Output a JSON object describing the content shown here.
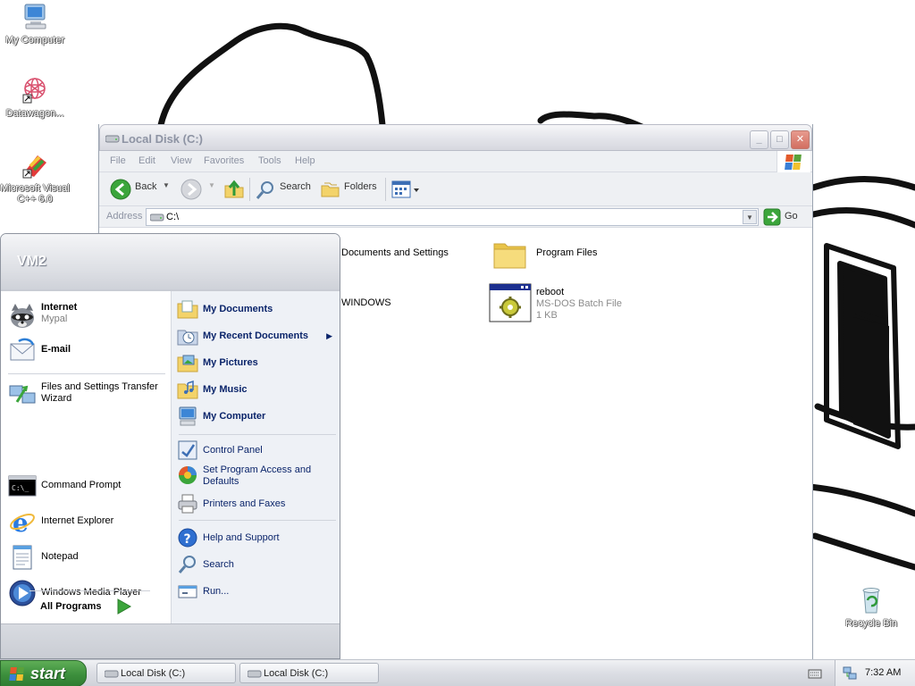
{
  "desktop": {
    "icons": [
      {
        "label": "My Computer",
        "icon": "my-computer-icon"
      },
      {
        "label": "Datawagon...",
        "icon": "datawagon-icon"
      },
      {
        "label": "Microsoft Visual C++ 6.0",
        "icon": "visual-cpp-icon"
      },
      {
        "label": "Recycle Bin",
        "icon": "recycle-bin-icon"
      }
    ]
  },
  "explorer": {
    "title": "Local Disk (C:)",
    "menu": [
      "File",
      "Edit",
      "View",
      "Favorites",
      "Tools",
      "Help"
    ],
    "toolbar": {
      "back": "Back",
      "search": "Search",
      "folders": "Folders"
    },
    "address": {
      "label": "Address",
      "value": "C:\\",
      "go": "Go"
    },
    "files": [
      {
        "name": "Documents and Settings",
        "type": "folder"
      },
      {
        "name": "Program Files",
        "type": "folder"
      },
      {
        "name": "WINDOWS",
        "type": "folder"
      },
      {
        "name": "reboot",
        "type": "batch",
        "detail": "MS-DOS Batch File",
        "size": "1 KB"
      }
    ]
  },
  "start_menu": {
    "user": "VM2",
    "pinned": [
      {
        "title": "Internet",
        "subtitle": "Mypal"
      },
      {
        "title": "E-mail",
        "subtitle": ""
      }
    ],
    "recent": [
      {
        "title": "Files and Settings Transfer Wizard"
      },
      {
        "title": "Command Prompt"
      },
      {
        "title": "Internet Explorer"
      },
      {
        "title": "Notepad"
      },
      {
        "title": "Windows Media Player"
      }
    ],
    "all_programs": "All Programs",
    "places": [
      {
        "title": "My Documents"
      },
      {
        "title": "My Recent Documents"
      },
      {
        "title": "My Pictures"
      },
      {
        "title": "My Music"
      },
      {
        "title": "My Computer"
      }
    ],
    "settings": [
      {
        "title": "Control Panel"
      },
      {
        "title": "Set Program Access and Defaults"
      },
      {
        "title": "Printers and Faxes"
      }
    ],
    "tools": [
      {
        "title": "Help and Support"
      },
      {
        "title": "Search"
      },
      {
        "title": "Run..."
      }
    ]
  },
  "taskbar": {
    "start": "start",
    "tasks": [
      "Local Disk (C:)",
      "Local Disk (C:)"
    ],
    "clock": "7:32 AM"
  },
  "colors": {
    "start_green": "#3c8f3c",
    "link_blue": "#0a246a",
    "accent_blue": "#316ac5"
  }
}
